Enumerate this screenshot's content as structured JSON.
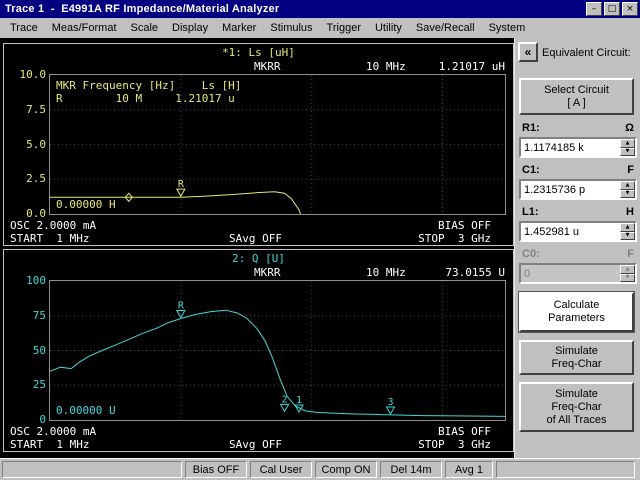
{
  "window": {
    "title": "Trace 1  -  E4991A RF Impedance/Material Analyzer",
    "controls": {
      "minimize": "–",
      "maximize": "□",
      "close": "×"
    }
  },
  "menu": {
    "items": [
      "Trace",
      "Meas/Format",
      "Scale",
      "Display",
      "Marker",
      "Stimulus",
      "Trigger",
      "Utility",
      "Save/Recall",
      "System"
    ]
  },
  "graph1": {
    "title": "*1: Ls [uH]",
    "mkr_label": "MKRR",
    "mkr_freq": "10 MHz",
    "mkr_value": "1.21017 uH",
    "table_header": "MKR Frequency [Hz]    Ls [H]",
    "table_row": "R        10 M     1.21017 u",
    "ref_value": "0.00000 H",
    "osc": "OSC 2.0000 mA",
    "bias": "BIAS OFF",
    "start": "START  1 MHz",
    "savg": "SAvg OFF",
    "stop": "STOP  3 GHz"
  },
  "graph2": {
    "title": "2: Q [U]",
    "mkr_label": "MKRR",
    "mkr_freq": "10 MHz",
    "mkr_value": "73.0155 U",
    "ref_value": "0.00000 U",
    "osc": "OSC 2.0000 mA",
    "bias": "BIAS OFF",
    "start": "START  1 MHz",
    "savg": "SAvg OFF",
    "stop": "STOP  3 GHz"
  },
  "sidebar": {
    "collapse_label": "«",
    "title": "Equivalent Circuit:",
    "select_circuit_label": "Select Circuit\n[ A ]",
    "fields": [
      {
        "label": "R1:",
        "unit": "Ω",
        "value": "1.1174185 k",
        "enabled": true
      },
      {
        "label": "C1:",
        "unit": "F",
        "value": "1.2315736 p",
        "enabled": true
      },
      {
        "label": "L1:",
        "unit": "H",
        "value": "1.452981 u",
        "enabled": true
      },
      {
        "label": "C0:",
        "unit": "F",
        "value": "0",
        "enabled": false
      }
    ],
    "spinner_up": "▲",
    "spinner_down": "▼",
    "calculate_label": "Calculate\nParameters",
    "simulate_label": "Simulate\nFreq-Char",
    "simulate_all_label": "Simulate\nFreq-Char\nof All Traces"
  },
  "statusbar": {
    "items": [
      "Bias OFF",
      "Cal User",
      "Comp ON",
      "Del 14m",
      "Avg 1"
    ]
  },
  "chart_data": [
    {
      "type": "line",
      "title": "*1: Ls [uH]",
      "x_scale": "log",
      "x_unit": "MHz",
      "x_range": [
        1,
        3000
      ],
      "x_start_label": "START  1 MHz",
      "x_stop_label": "STOP  3 GHz",
      "ylim": [
        0,
        10
      ],
      "yticks": [
        "10.0",
        "7.5",
        "5.0",
        "2.5",
        "0.0"
      ],
      "color": "#e8e878",
      "points": [
        [
          1,
          1.2
        ],
        [
          2,
          1.2
        ],
        [
          4,
          1.2
        ],
        [
          7,
          1.21
        ],
        [
          10,
          1.21
        ],
        [
          15,
          1.27
        ],
        [
          25,
          1.4
        ],
        [
          40,
          1.55
        ],
        [
          52,
          1.6
        ],
        [
          62,
          1.5
        ],
        [
          70,
          1.1
        ],
        [
          80,
          0.3
        ],
        [
          88,
          -0.8
        ]
      ],
      "markers": [
        {
          "label": "",
          "shape": "diamond",
          "freq": 4,
          "value": 1.2
        },
        {
          "label": "R",
          "shape": "triangle",
          "freq": 10,
          "value": 1.21
        }
      ]
    },
    {
      "type": "line",
      "title": "2: Q [U]",
      "x_scale": "log",
      "x_unit": "MHz",
      "x_range": [
        1,
        3000
      ],
      "x_start_label": "START  1 MHz",
      "x_stop_label": "STOP  3 GHz",
      "ylim": [
        0,
        100
      ],
      "yticks": [
        "100",
        "75",
        "50",
        "25",
        "0"
      ],
      "color": "#40d8d8",
      "points": [
        [
          1,
          35
        ],
        [
          1.2,
          38
        ],
        [
          1.45,
          37
        ],
        [
          1.7,
          42
        ],
        [
          2,
          46
        ],
        [
          2.5,
          50
        ],
        [
          3,
          53
        ],
        [
          4,
          58
        ],
        [
          5,
          62
        ],
        [
          6.5,
          66
        ],
        [
          8,
          70
        ],
        [
          10,
          73
        ],
        [
          13,
          76
        ],
        [
          17,
          78
        ],
        [
          22,
          79
        ],
        [
          27,
          77
        ],
        [
          32,
          73
        ],
        [
          38,
          66
        ],
        [
          44,
          57
        ],
        [
          50,
          45
        ],
        [
          57,
          30
        ],
        [
          65,
          17
        ],
        [
          75,
          10
        ],
        [
          90,
          6.5
        ],
        [
          110,
          5.5
        ],
        [
          150,
          4.8
        ],
        [
          200,
          4.4
        ],
        [
          300,
          4
        ],
        [
          450,
          3.6
        ],
        [
          700,
          3.2
        ],
        [
          1000,
          3
        ],
        [
          2000,
          2.8
        ],
        [
          3000,
          2.6
        ]
      ],
      "markers": [
        {
          "label": "R",
          "shape": "triangle",
          "freq": 10,
          "value": 73
        },
        {
          "label": "2",
          "shape": "triangle",
          "freq": 62,
          "value": 5.5
        },
        {
          "label": "1",
          "shape": "triangle",
          "freq": 80,
          "value": 5
        },
        {
          "label": "3",
          "shape": "triangle",
          "freq": 400,
          "value": 3.6
        }
      ]
    }
  ]
}
